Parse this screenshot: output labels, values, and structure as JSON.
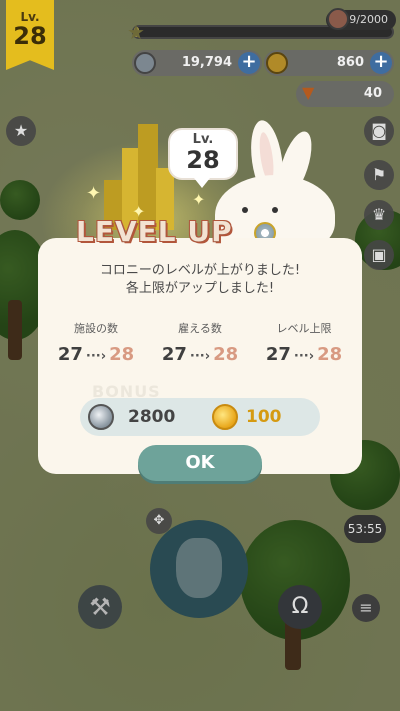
{
  "hud": {
    "level_label": "Lv.",
    "level_value": "28",
    "xp_text": "29/2000",
    "xp_progress": 0.0145,
    "currency_silver": "19,794",
    "currency_gold": "860",
    "carrots": "40"
  },
  "levelup": {
    "title": "LEVEL UP",
    "bubble_label": "Lv.",
    "bubble_value": "28"
  },
  "dialog": {
    "message_line1": "コロニーのレベルが上がりました!",
    "message_line2": "各上限がアップしました!",
    "stats": [
      {
        "label": "施設の数",
        "old": "27",
        "new": "28"
      },
      {
        "label": "雇える数",
        "old": "27",
        "new": "28"
      },
      {
        "label": "レベル上限",
        "old": "27",
        "new": "28"
      }
    ],
    "arrow": "···›",
    "bonus_title": "BONUS",
    "bonus_silver": "2800",
    "bonus_gold": "100",
    "ok_label": "OK"
  },
  "bottom": {
    "timer": "53:55"
  },
  "colors": {
    "accent_new_value": "#d89a82",
    "ok_button": "#6ea39a",
    "gold": "#d59a11"
  },
  "icons": [
    "star-icon",
    "plus-icon",
    "coin-silver-icon",
    "coin-gold-icon",
    "carrot-icon",
    "camera-icon",
    "flag-icon",
    "trophy-icon",
    "gift-icon",
    "hammer-icon",
    "rabbit-icon",
    "menu-icon"
  ]
}
